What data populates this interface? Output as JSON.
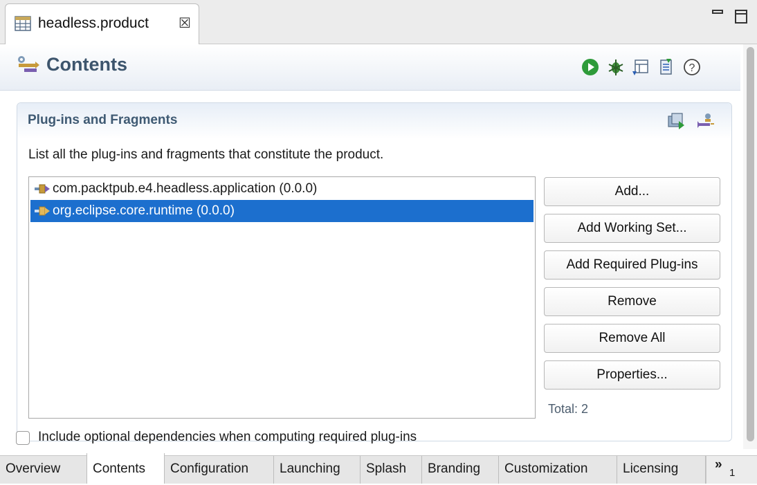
{
  "editor_tab": {
    "title": "headless.product",
    "close_glyph": "☒"
  },
  "window_controls": {
    "minimize_icon": "minimize-icon",
    "maximize_icon": "maximize-icon"
  },
  "form": {
    "title": "Contents",
    "toolbar_icons": [
      "run-icon",
      "debug-icon",
      "export-wizard-icon",
      "launch-config-icon",
      "help-icon"
    ]
  },
  "section": {
    "title": "Plug-ins and Fragments",
    "description": "List all the plug-ins and fragments that constitute the product.",
    "header_icons": [
      "add-plugin-icon",
      "plugin-dependency-icon"
    ],
    "items": [
      {
        "label": "com.packtpub.e4.headless.application (0.0.0)",
        "selected": false
      },
      {
        "label": "org.eclipse.core.runtime (0.0.0)",
        "selected": true
      }
    ],
    "buttons": {
      "add": "Add...",
      "add_working_set": "Add Working Set...",
      "add_required": "Add Required Plug-ins",
      "remove": "Remove",
      "remove_all": "Remove All",
      "properties": "Properties..."
    },
    "total": "Total: 2"
  },
  "option": {
    "label": "Include optional dependencies when computing required plug-ins",
    "checked": false
  },
  "page_tabs": {
    "items": [
      "Overview",
      "Contents",
      "Configuration",
      "Launching",
      "Splash",
      "Branding",
      "Customization",
      "Licensing"
    ],
    "active": "Contents",
    "more_glyph": "»",
    "more_count": "1"
  },
  "colors": {
    "accent_selection": "#1c6fce",
    "header_title": "#3d556d",
    "run_green": "#2e9b3a"
  }
}
